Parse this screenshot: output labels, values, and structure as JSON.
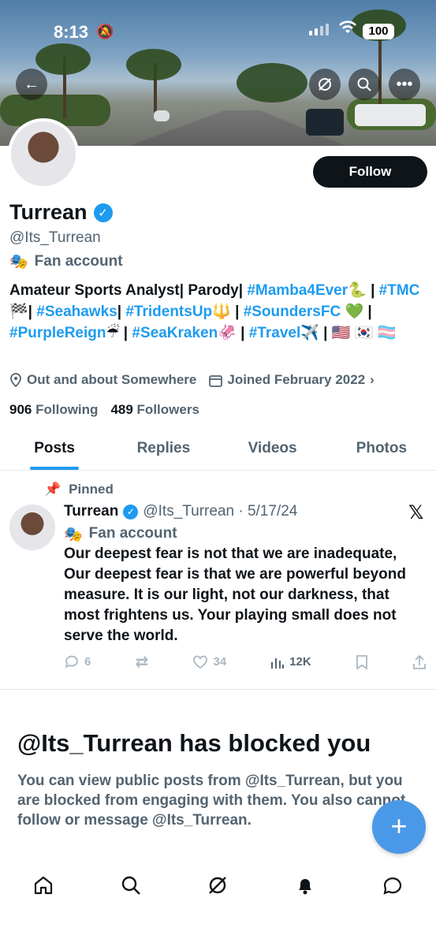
{
  "status_bar": {
    "time": "8:13",
    "battery": "100"
  },
  "profile": {
    "name": "Turrean",
    "handle": "@Its_Turrean",
    "category": "Fan account",
    "follow_label": "Follow",
    "bio_parts": [
      {
        "text": "Amateur Sports Analyst| Parody| ",
        "tag": false
      },
      {
        "text": "#Mamba4Ever",
        "tag": true
      },
      {
        "text": "🐍 | ",
        "tag": false
      },
      {
        "text": "#TMC",
        "tag": true
      },
      {
        "text": "🏁| ",
        "tag": false
      },
      {
        "text": "#Seahawks",
        "tag": true
      },
      {
        "text": "| ",
        "tag": false
      },
      {
        "text": "#TridentsUp",
        "tag": true
      },
      {
        "text": "🔱 | ",
        "tag": false
      },
      {
        "text": "#SoundersFC",
        "tag": true
      },
      {
        "text": " 💚 | ",
        "tag": false
      },
      {
        "text": "#PurpleReign",
        "tag": true
      },
      {
        "text": "☔ | ",
        "tag": false
      },
      {
        "text": "#SeaKraken",
        "tag": true
      },
      {
        "text": "🦑 | ",
        "tag": false
      },
      {
        "text": "#Travel",
        "tag": true
      },
      {
        "text": "✈️ | 🇺🇸 🇰🇷 🏳️‍⚧️",
        "tag": false
      }
    ],
    "location": "Out and about Somewhere",
    "joined": "Joined February 2022",
    "following_count": "906",
    "following_label": "Following",
    "followers_count": "489",
    "followers_label": "Followers"
  },
  "tabs": [
    "Posts",
    "Replies",
    "Videos",
    "Photos"
  ],
  "pinned_post": {
    "pinned_label": "Pinned",
    "author": "Turrean",
    "handle_date": "@Its_Turrean · 5/17/24",
    "category": "Fan account",
    "text": "Our deepest fear is not that we are inadequate, Our deepest fear is that we are powerful beyond measure. It is our light, not our darkness, that most frightens us. Your playing small does not serve the world.",
    "replies": "6",
    "likes": "34",
    "views": "12K"
  },
  "blocked": {
    "title": "@Its_Turrean has blocked you",
    "text": "You can view public posts from @Its_Turrean, but you are blocked from engaging with them. You also cannot follow or message @Its_Turrean."
  }
}
